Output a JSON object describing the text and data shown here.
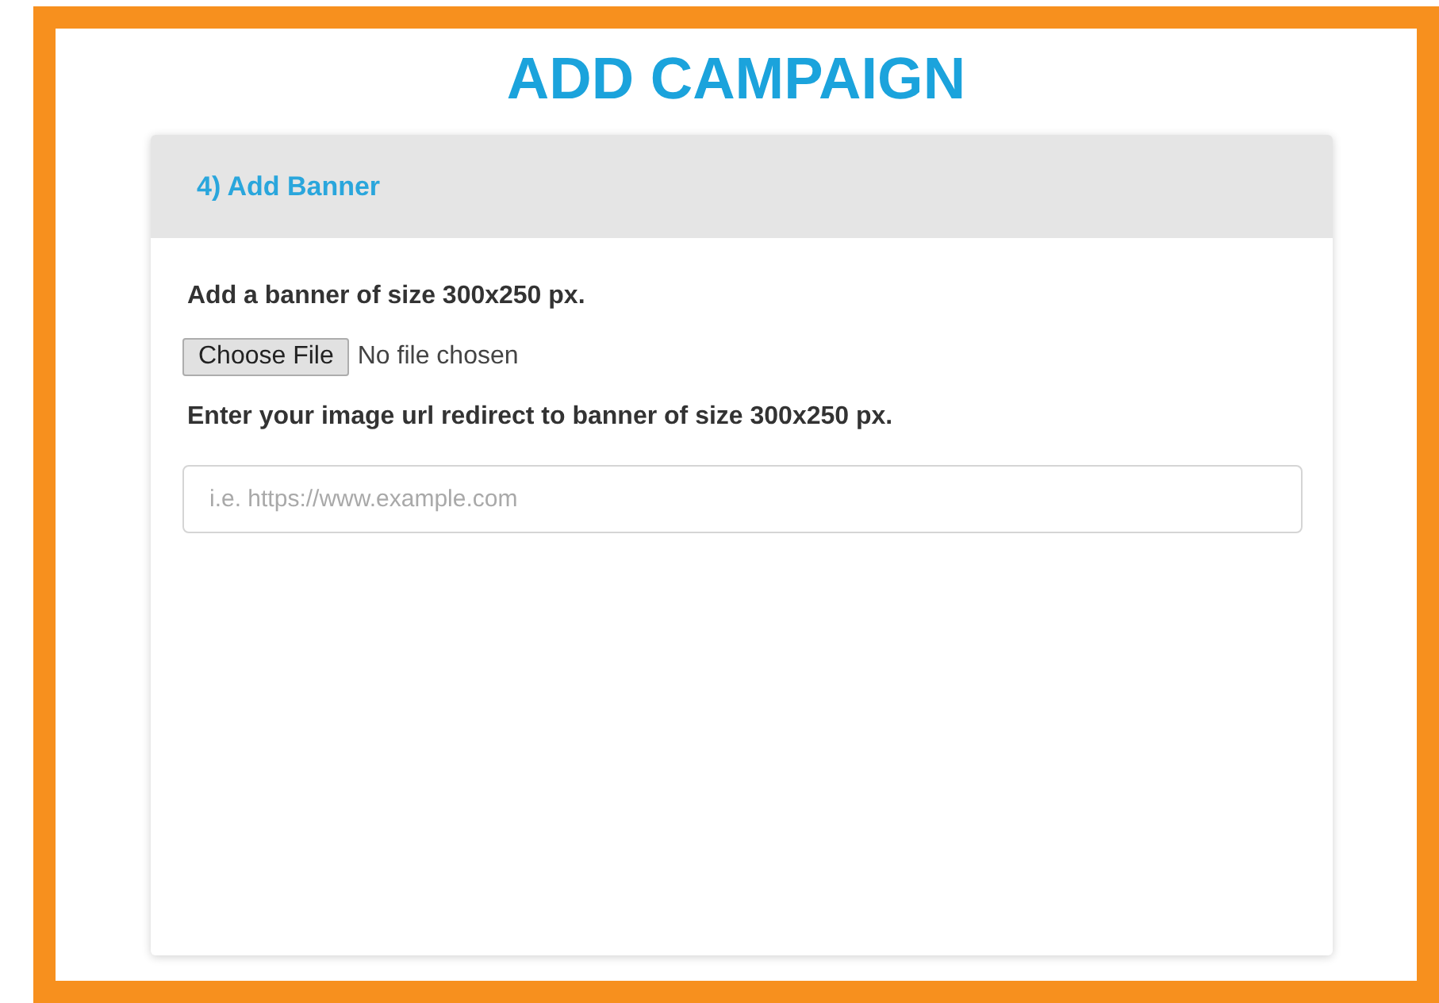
{
  "title": "ADD CAMPAIGN",
  "panel": {
    "heading": "4) Add Banner",
    "upload_label": "Add a banner of size 300x250 px.",
    "file_button": "Choose File",
    "file_status": "No file chosen",
    "url_label": "Enter your image url redirect to banner of size 300x250 px.",
    "url_field": {
      "placeholder": "i.e. https://www.example.com"
    }
  }
}
